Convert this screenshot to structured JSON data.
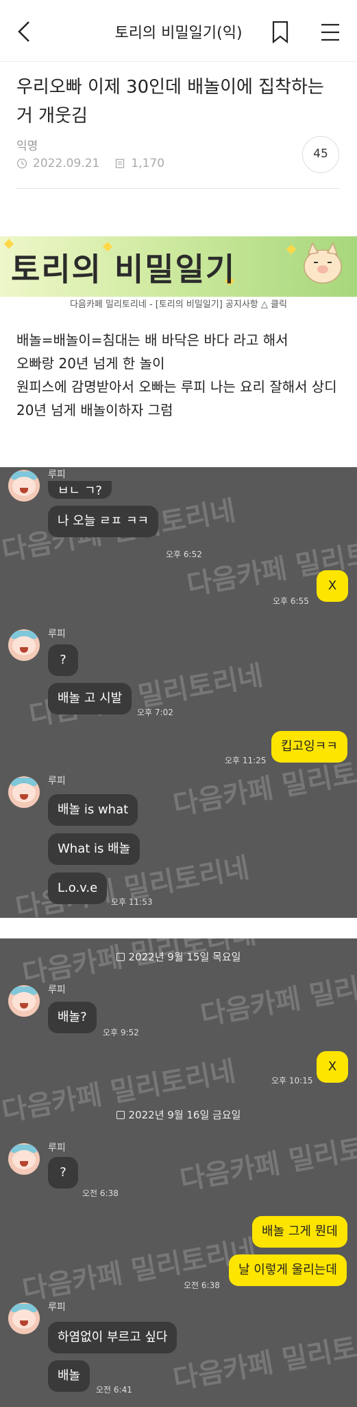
{
  "header": {
    "cafe_title": "토리의 비밀일기(익)",
    "back_icon": "back-arrow-icon",
    "bookmark_icon": "bookmark-icon",
    "menu_icon": "hamburger-menu-icon"
  },
  "post": {
    "title": "우리오빠 이제 30인데 배놀이에 집착하는거 개웃김",
    "author": "익명",
    "date": "2022.09.21",
    "views": "1,170",
    "comment_count": "45"
  },
  "banner": {
    "title": "토리의 비밀일기",
    "notice": "다음카페 밀리토리네 - [토리의 비밀일기] 공지사항 △ 클릭"
  },
  "body_lines": [
    "배놀=배놀이=침대는 배 바닥은 바다 라고 해서",
    "오빠랑 20년 넘게 한 놀이",
    "원피스에 감명받아서 오빠는 루피 나는 요리 잘해서 상디",
    "20년 넘게 배놀이하자 그럼"
  ],
  "chat1": {
    "name_1": "루피",
    "msg_partial": "ㅂㄴ ㄱ?",
    "msg_1": "나 오늘 ㄹㅍ ㅋㅋ",
    "time_1": "오후 6:52",
    "me_1": "X",
    "time_2": "오후 6:55",
    "name_2": "루피",
    "msg_2": "?",
    "msg_3": "배놀 고 시발",
    "time_3": "오후 7:02",
    "me_2": "킵고잉ㅋㅋ",
    "time_4": "오후 11:25",
    "name_3": "루피",
    "msg_4": "배놀 is what",
    "msg_5": "What is 배놀",
    "msg_6": "L.o.v.e",
    "time_5": "오후 11:53"
  },
  "chat2": {
    "date_1": "2022년 9월 15일 목요일",
    "name_1": "루피",
    "msg_1": "배놀?",
    "time_1": "오후 9:52",
    "me_1": "X",
    "time_2": "오후 10:15",
    "date_2": "2022년 9월 16일 금요일",
    "name_2": "루피",
    "msg_2": "?",
    "time_3": "오전 6:38",
    "me_2": "배놀 그게 뭔데",
    "me_3": "날 이렇게 울리는데",
    "time_4": "오전 6:38",
    "name_3": "루피",
    "msg_3": "하염없이 부르고 싶다",
    "msg_4": "배놀",
    "time_5": "오전 6:41"
  },
  "watermark": "다음카페 밀리토리네",
  "colors": {
    "chat_bg": "#595959",
    "bubble_other": "#3a3a3a",
    "bubble_me": "#fee500"
  }
}
